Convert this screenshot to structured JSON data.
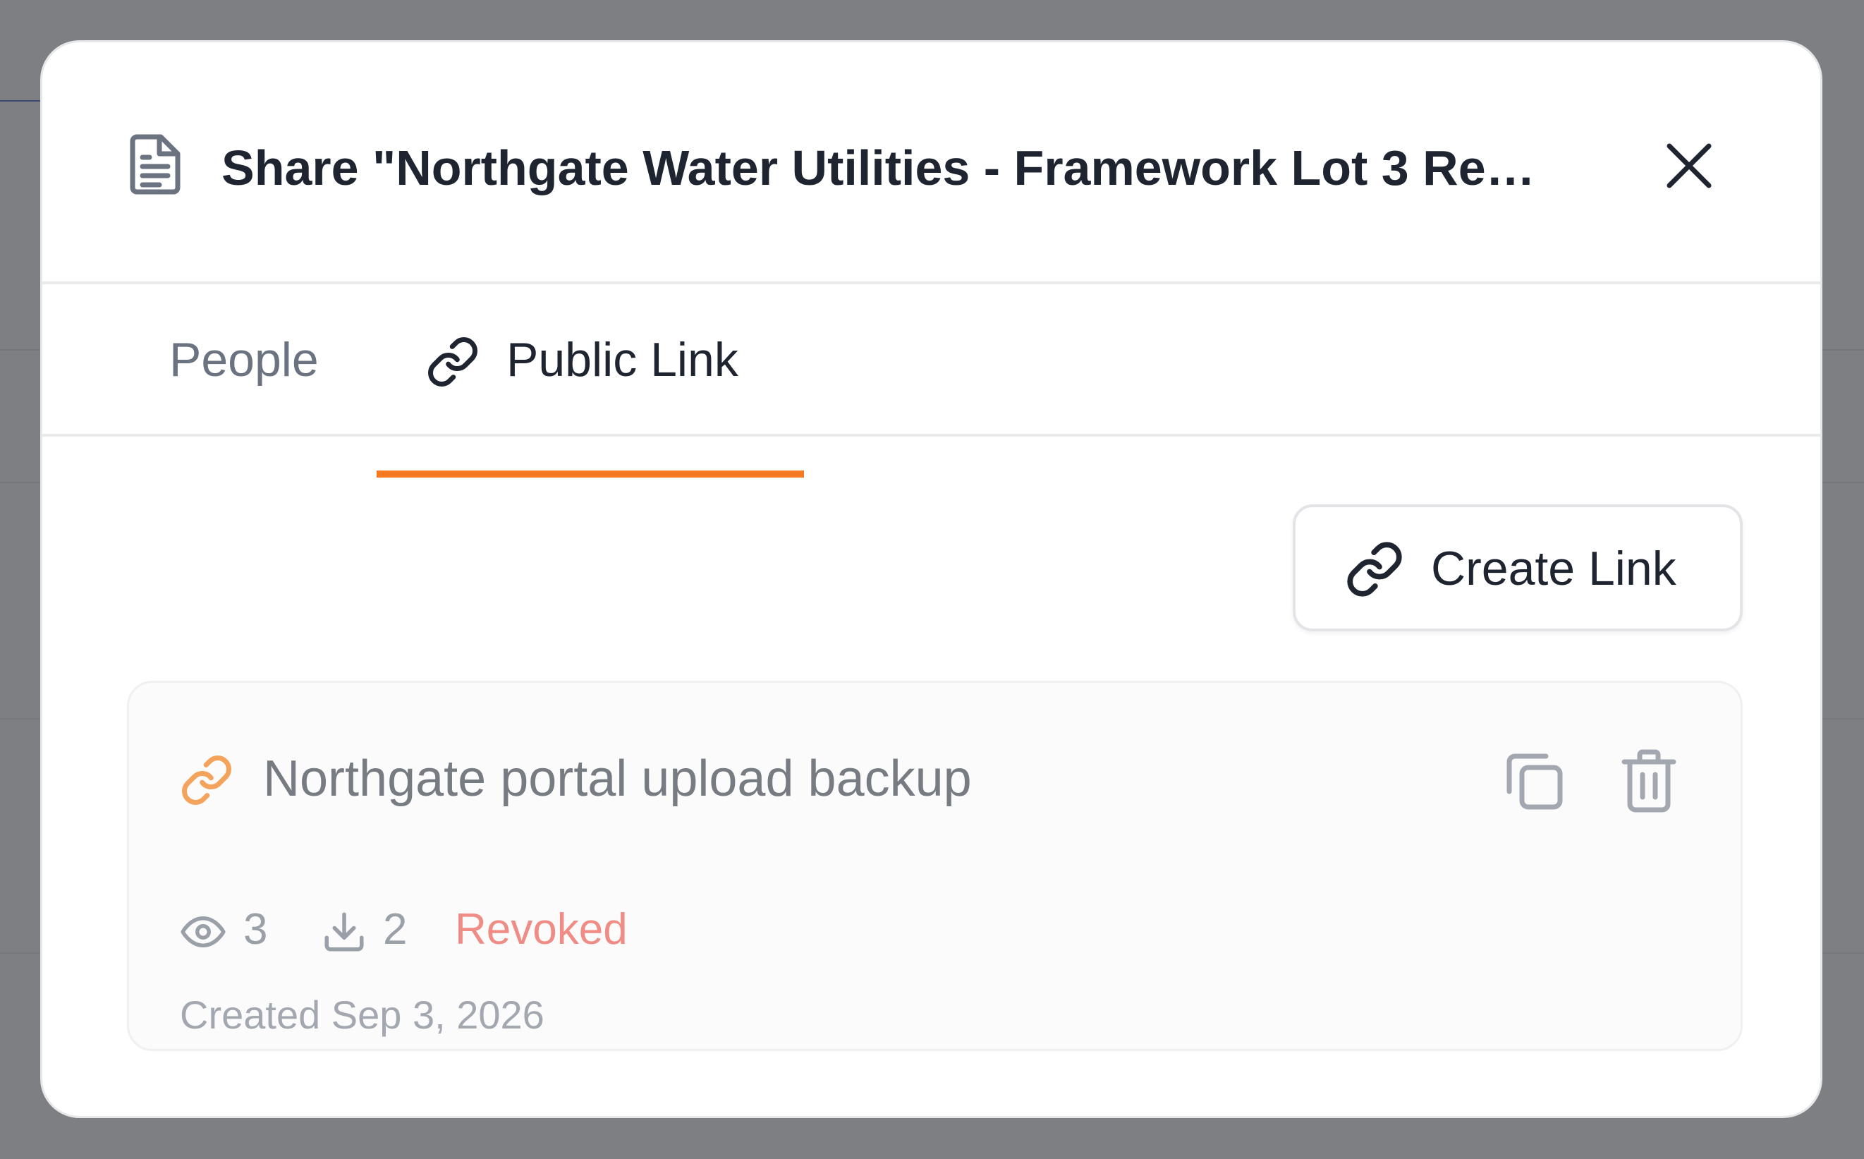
{
  "dialog": {
    "title": "Share \"Northgate Water Utilities - Framework Lot 3 Re…"
  },
  "icons": {
    "document": "document-icon",
    "close": "close-icon",
    "link": "link-icon",
    "copy": "copy-icon",
    "trash": "trash-icon",
    "eye": "eye-icon",
    "download": "download-icon"
  },
  "tabs": [
    {
      "label": "People",
      "active": false
    },
    {
      "label": "Public Link",
      "active": true
    }
  ],
  "actions": {
    "create_link_label": "Create Link"
  },
  "links": [
    {
      "name": "Northgate portal upload backup",
      "views": "3",
      "downloads": "2",
      "status": "Revoked",
      "created": "Created Sep 3, 2026"
    }
  ],
  "colors": {
    "accent": "#f47920",
    "revoked": "#f08c86",
    "link_icon_inactive": "#f4a35c"
  }
}
